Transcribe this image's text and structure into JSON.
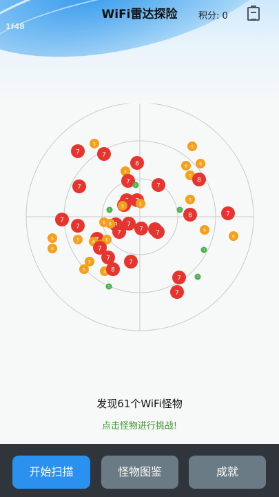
{
  "header": {
    "title": "WiFi雷达探险",
    "score_label": "积分: 0",
    "ssid_text": "1f48",
    "clipboard_icon": "clipboard-icon"
  },
  "radar": {
    "monsters": [
      {
        "level": 7,
        "color": "red"
      },
      {
        "level": 5,
        "color": "orange"
      },
      {
        "level": 5,
        "color": "orange"
      },
      {
        "level": 7,
        "color": "red"
      },
      {
        "level": 8,
        "color": "red"
      },
      {
        "level": 4,
        "color": "orange"
      },
      {
        "level": 6,
        "color": "orange"
      },
      {
        "level": 6,
        "color": "orange"
      },
      {
        "level": 5,
        "color": "orange"
      },
      {
        "level": 7,
        "color": "red"
      },
      {
        "level": 2,
        "color": "green"
      },
      {
        "level": 7,
        "color": "red"
      },
      {
        "level": 8,
        "color": "red"
      },
      {
        "level": 7,
        "color": "red"
      },
      {
        "level": 7,
        "color": "red"
      },
      {
        "level": 7,
        "color": "red"
      },
      {
        "level": 7,
        "color": "red"
      },
      {
        "level": 5,
        "color": "orange"
      },
      {
        "level": 5,
        "color": "orange"
      },
      {
        "level": 5,
        "color": "orange"
      },
      {
        "level": 3,
        "color": "green"
      },
      {
        "level": 1,
        "color": "green"
      },
      {
        "level": 7,
        "color": "red"
      },
      {
        "level": 7,
        "color": "red"
      },
      {
        "level": 8,
        "color": "red"
      },
      {
        "level": 7,
        "color": "red"
      },
      {
        "level": 6,
        "color": "orange"
      },
      {
        "level": 8,
        "color": "red"
      },
      {
        "level": 7,
        "color": "red"
      },
      {
        "level": 6,
        "color": "orange"
      },
      {
        "level": 7,
        "color": "red"
      },
      {
        "level": 7,
        "color": "red"
      },
      {
        "level": 7,
        "color": "red"
      },
      {
        "level": 6,
        "color": "orange"
      },
      {
        "level": 7,
        "color": "red"
      },
      {
        "level": 5,
        "color": "orange"
      },
      {
        "level": 5,
        "color": "orange"
      },
      {
        "level": 7,
        "color": "red"
      },
      {
        "level": 6,
        "color": "orange"
      },
      {
        "level": 6,
        "color": "orange"
      },
      {
        "level": 5,
        "color": "orange"
      },
      {
        "level": 7,
        "color": "red"
      },
      {
        "level": 3,
        "color": "green"
      },
      {
        "level": 6,
        "color": "orange"
      },
      {
        "level": 7,
        "color": "red"
      },
      {
        "level": 7,
        "color": "red"
      },
      {
        "level": 5,
        "color": "orange"
      },
      {
        "level": 5,
        "color": "orange"
      },
      {
        "level": 4,
        "color": "orange"
      },
      {
        "level": 8,
        "color": "red"
      },
      {
        "level": 3,
        "color": "green"
      },
      {
        "level": 7,
        "color": "red"
      },
      {
        "level": 1,
        "color": "green"
      },
      {
        "level": 7,
        "color": "red"
      },
      {
        "level": 6,
        "color": "orange"
      }
    ]
  },
  "status": {
    "found_text": "发现61个WiFi怪物",
    "hint_text": "点击怪物进行挑战!"
  },
  "nav": {
    "scan_label": "开始扫描",
    "dex_label": "怪物图鉴",
    "achievements_label": "成就"
  },
  "colors": {
    "red": "#e5352e",
    "orange": "#f5a01c",
    "green": "#4caf50",
    "primary": "#2b91ee",
    "secondary": "#6b7b86",
    "navbar": "#2f353a",
    "hint": "#3c9a2e"
  }
}
